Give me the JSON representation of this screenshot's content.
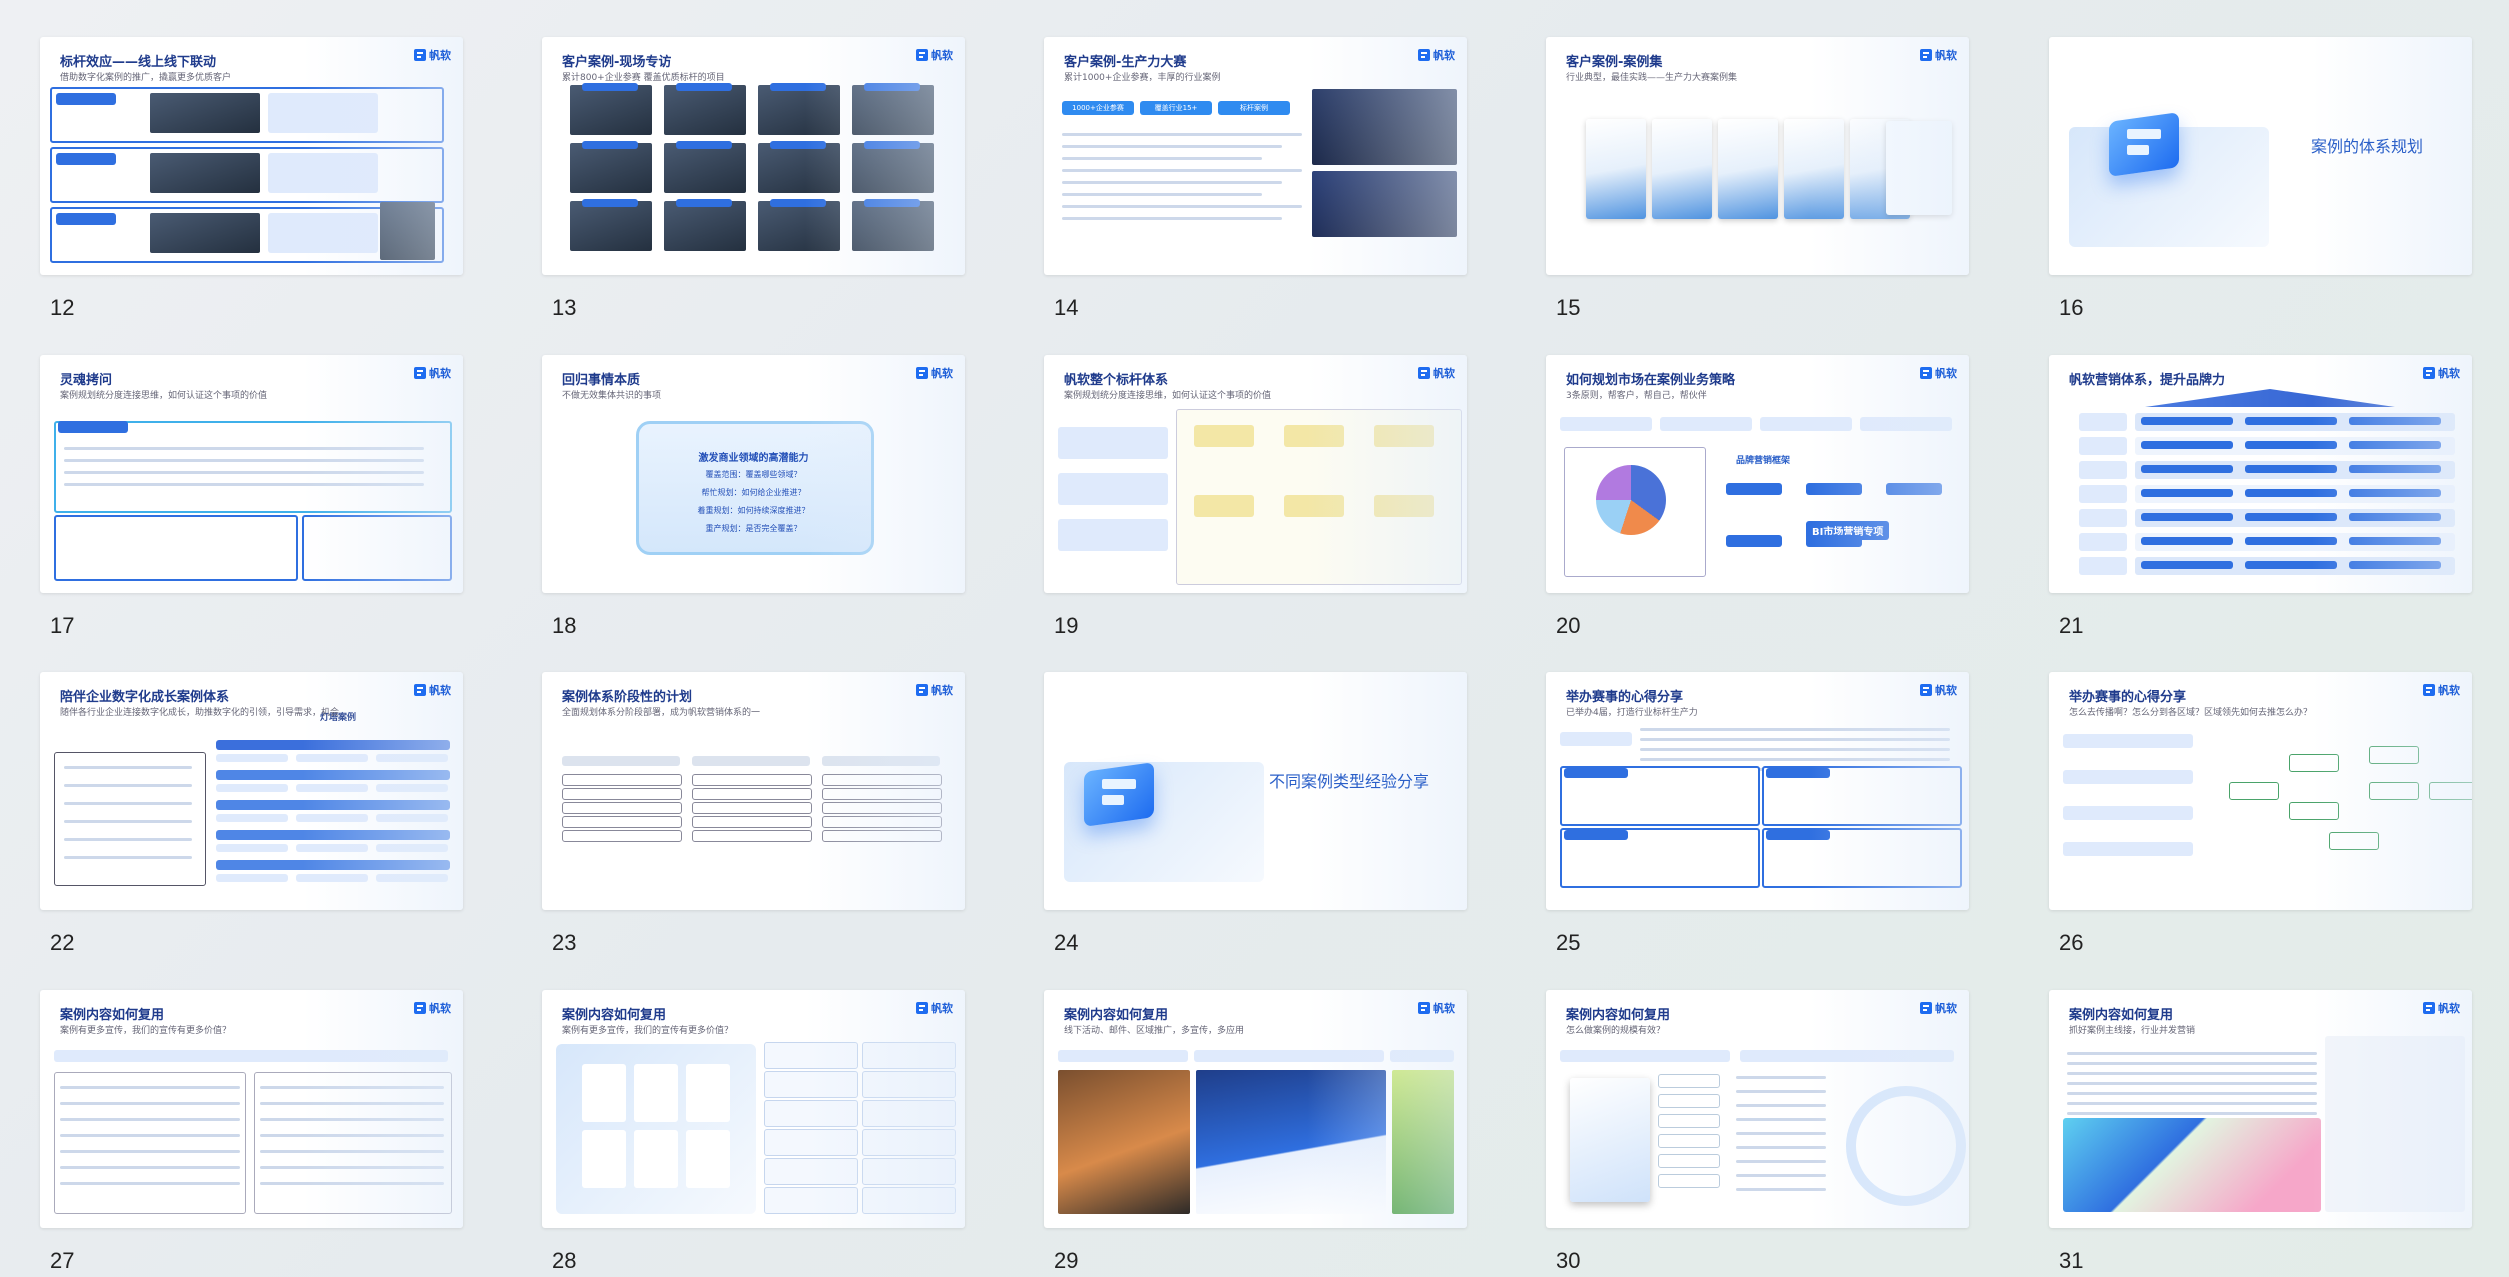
{
  "brand": {
    "logo_text": "帆软",
    "accent": "#2f6fe0"
  },
  "slides": [
    {
      "num": "12",
      "title": "标杆效应——线上线下联动",
      "subtitle": "借助数字化案例的推广，撬赢更多优质客户"
    },
    {
      "num": "13",
      "title": "客户案例-现场专访",
      "subtitle": "累计800+企业参赛 覆盖优质标杆的项目"
    },
    {
      "num": "14",
      "title": "客户案例-生产力大赛",
      "subtitle": "累计1000+企业参赛，丰厚的行业案例",
      "badges": [
        "1000+企业参赛",
        "覆盖行业15+",
        "标杆案例"
      ]
    },
    {
      "num": "15",
      "title": "客户案例-案例集",
      "subtitle": "行业典型，最佳实践——生产力大赛案例集"
    },
    {
      "num": "16",
      "title": "",
      "subtitle": "",
      "center_text": "案例的体系规划"
    },
    {
      "num": "17",
      "title": "灵魂拷问",
      "subtitle": "案例规划统分度连接思维，如何认证这个事项的价值"
    },
    {
      "num": "18",
      "title": "回归事情本质",
      "subtitle": "不做无效集体共识的事项",
      "panel_lines": [
        "激发商业领域的高潜能力",
        "覆盖范围：覆盖哪些领域？",
        "帮忙规划：如何给企业推进？",
        "着重规划：如何持续深度推进？",
        "重产规划：是否完全覆盖？"
      ]
    },
    {
      "num": "19",
      "title": "帆软整个标杆体系",
      "subtitle": "案例规划统分度连接思维，如何认证这个事项的价值"
    },
    {
      "num": "20",
      "title": "如何规划市场在案例业务策略",
      "subtitle": "3条原则，帮客户，帮自己，帮伙伴",
      "chips": [
        "品牌营销框架",
        "BI市场营销专项"
      ]
    },
    {
      "num": "21",
      "title": "帆软营销体系，提升品牌力",
      "subtitle": ""
    },
    {
      "num": "22",
      "title": "陪伴企业数字化成长案例体系",
      "subtitle": "随伴各行业企业连接数字化成长，助推数字化的引领，引导需求，机会",
      "header": "灯塔案例"
    },
    {
      "num": "23",
      "title": "案例体系阶段性的计划",
      "subtitle": "全面规划体系分阶段部署，成为帆软营销体系的一"
    },
    {
      "num": "24",
      "title": "",
      "subtitle": "",
      "center_text": "不同案例类型经验分享"
    },
    {
      "num": "25",
      "title": "举办赛事的心得分享",
      "subtitle": "已举办4届，打造行业标杆生产力"
    },
    {
      "num": "26",
      "title": "举办赛事的心得分享",
      "subtitle": "怎么去传播啊？怎么分到各区域？区域领先如何去推怎么办？"
    },
    {
      "num": "27",
      "title": "案例内容如何复用",
      "subtitle": "案例有更多宣传，我们的宣传有更多价值？"
    },
    {
      "num": "28",
      "title": "案例内容如何复用",
      "subtitle": "案例有更多宣传，我们的宣传有更多价值？"
    },
    {
      "num": "29",
      "title": "案例内容如何复用",
      "subtitle": "线下活动、邮件、区域推广，多宣传，多应用"
    },
    {
      "num": "30",
      "title": "案例内容如何复用",
      "subtitle": "怎么做案例的规模有效？"
    },
    {
      "num": "31",
      "title": "案例内容如何复用",
      "subtitle": "抓好案例主线接，行业并发营销"
    }
  ]
}
